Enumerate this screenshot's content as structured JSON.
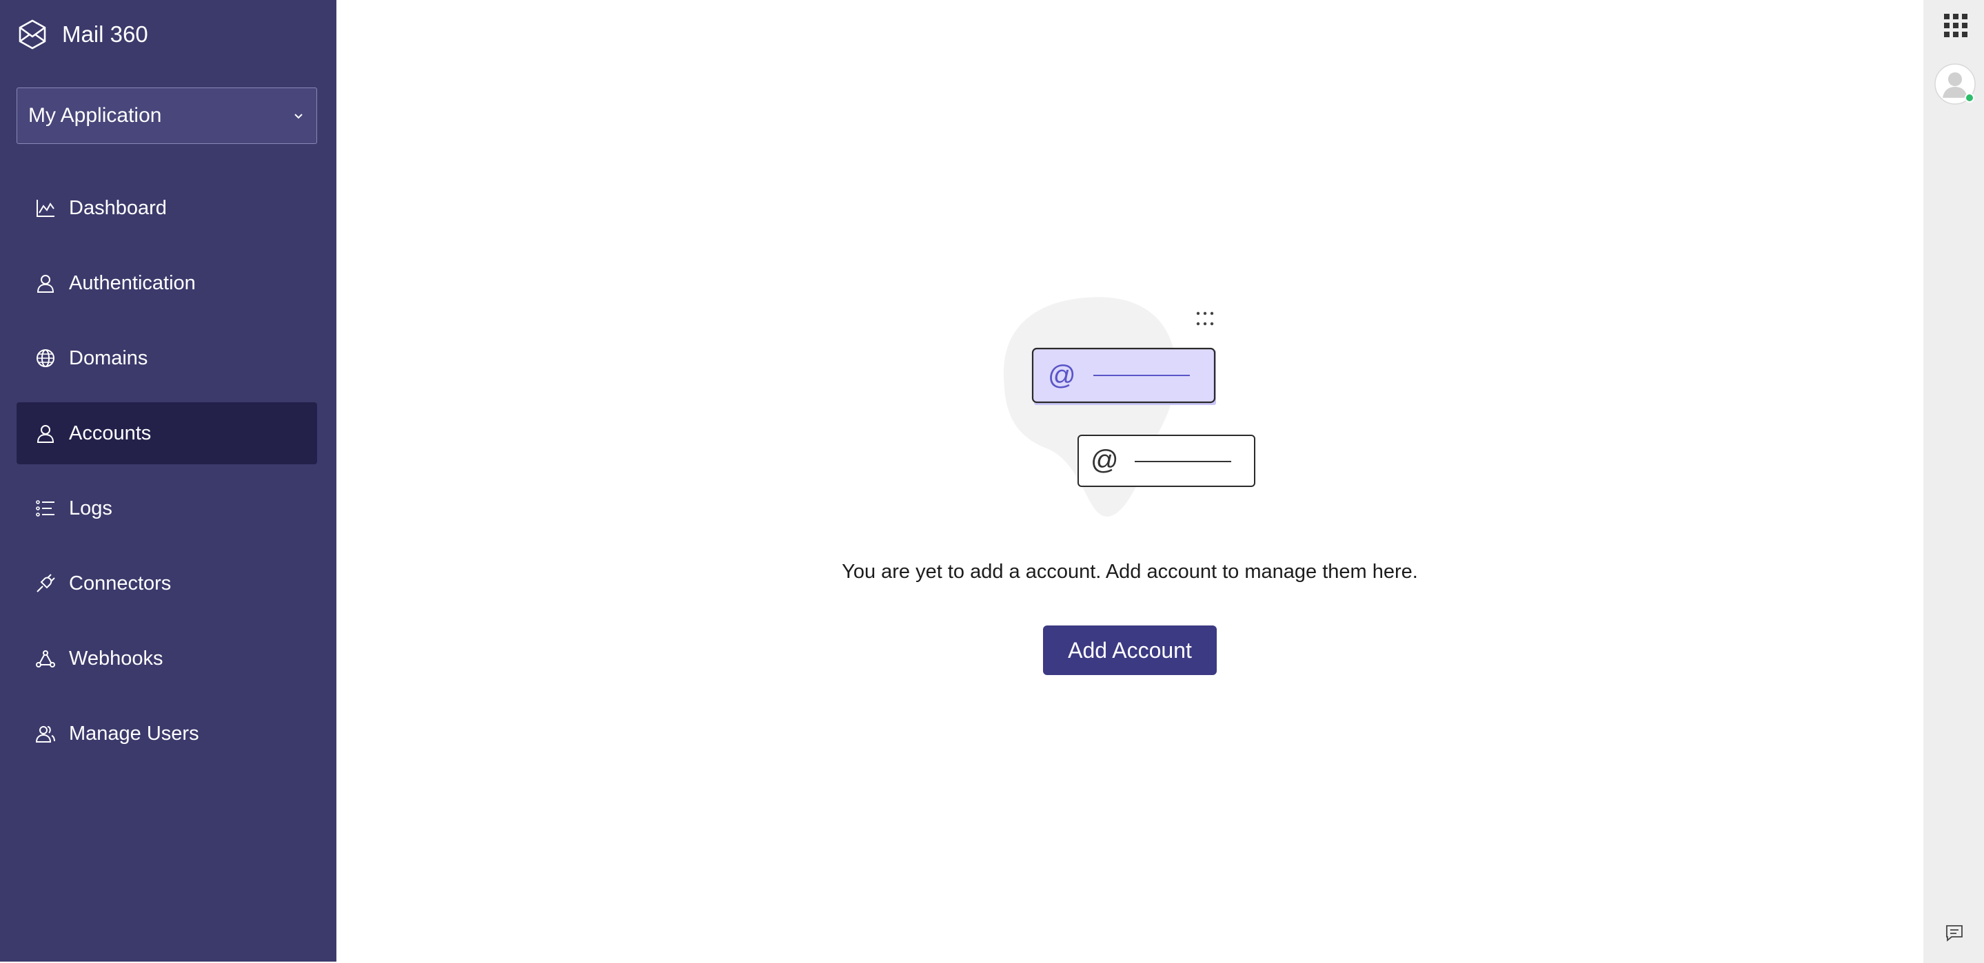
{
  "app": {
    "name": "Mail 360",
    "logo_icon": "mail-360-logo-icon"
  },
  "app_selector": {
    "selected": "My Application",
    "icon": "chevron-down-icon"
  },
  "sidebar": {
    "items": [
      {
        "label": "Dashboard",
        "icon": "chart-icon",
        "active": false
      },
      {
        "label": "Authentication",
        "icon": "user-icon",
        "active": false
      },
      {
        "label": "Domains",
        "icon": "globe-icon",
        "active": false
      },
      {
        "label": "Accounts",
        "icon": "user-icon",
        "active": true
      },
      {
        "label": "Logs",
        "icon": "list-icon",
        "active": false
      },
      {
        "label": "Connectors",
        "icon": "plug-icon",
        "active": false
      },
      {
        "label": "Webhooks",
        "icon": "webhook-icon",
        "active": false
      },
      {
        "label": "Manage Users",
        "icon": "users-icon",
        "active": false
      }
    ]
  },
  "empty_state": {
    "illustration": "email-fields-illustration",
    "at_symbol": "@",
    "message": "You are yet to add a account. Add account to manage them here.",
    "button_label": "Add Account"
  },
  "right_rail": {
    "apps_icon": "grid-apps-icon",
    "avatar": "user-avatar",
    "status": "online",
    "feedback_icon": "feedback-icon"
  },
  "colors": {
    "sidebar_bg": "#3c3a6b",
    "active_item_bg": "#23214a",
    "button_bg": "#3c3a83",
    "accent_light": "#d9d6fb",
    "online": "#2ebd6b"
  }
}
